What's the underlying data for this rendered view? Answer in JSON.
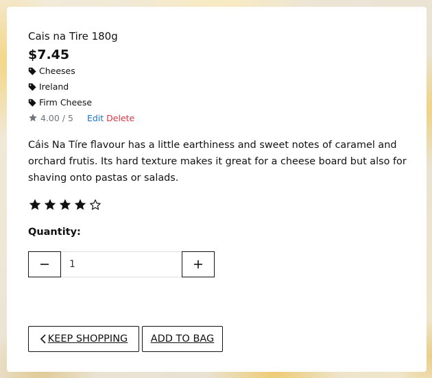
{
  "product": {
    "name": "Cais na Tire 180g",
    "price": "$7.45",
    "tags": [
      "Cheeses",
      "Ireland",
      "Firm Cheese"
    ],
    "rating_text": "4.00 / 5",
    "edit_label": "Edit",
    "delete_label": "Delete",
    "description": "Cáis Na Tíre flavour has a little earthiness and sweet notes of caramel and orchard frutis. Its hard texture makes it great for a cheese board but also for shaving onto pastas or salads.",
    "stars": {
      "filled": 4,
      "total": 5
    }
  },
  "quantity": {
    "label": "Quantity:",
    "value": "1",
    "decrement_symbol": "−",
    "increment_symbol": "+"
  },
  "actions": {
    "keep_shopping_label": "KEEP SHOPPING",
    "add_to_bag_label": "ADD TO BAG"
  },
  "icons": {
    "tag": "tag-icon",
    "rating_star": "star-icon",
    "back": "chevron-left-icon"
  },
  "colors": {
    "edit_link": "#1a73c8",
    "delete_link": "#dc3545",
    "muted_text": "#6c757d"
  }
}
